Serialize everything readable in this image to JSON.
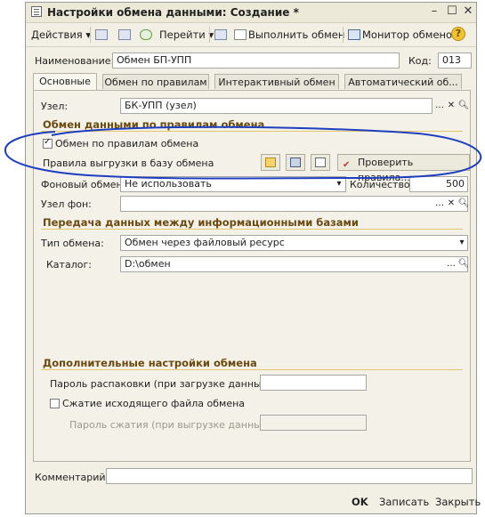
{
  "window": {
    "title": "Настройки обмена данными: Создание *"
  },
  "toolbar": {
    "actions": "Действия",
    "goto": "Перейти",
    "run_exchange": "Выполнить обмен",
    "monitor": "Монитор обменов",
    "help": "?"
  },
  "header": {
    "name_label": "Наименование:",
    "name_value": "Обмен БП-УПП",
    "code_label": "Код:",
    "code_value": "013"
  },
  "tabs": [
    "Основные",
    "Обмен по правилам",
    "Интерактивный обмен",
    "Автоматический об..."
  ],
  "rules_section": {
    "title": "Обмен данными по правилам обмена",
    "node_label": "Узел:",
    "node_value": "БК-УПП (узел)",
    "use_rules_label": "Обмен по правилам обмена",
    "use_rules_checked": true,
    "rules_label": "Правила выгрузки в базу обмена",
    "check_rules": "Проверить правила..."
  },
  "background": {
    "label": "Фоновый обмен:",
    "value": "Не использовать",
    "count_label": "Количество:",
    "count_value": "500",
    "node_bg_label": "Узел фон:"
  },
  "transfer_section": {
    "title": "Передача данных между информационными базами",
    "type_label": "Тип обмена:",
    "type_value": "Обмен через файловый ресурс",
    "catalog_label": "Каталог:",
    "catalog_value": "D:\\обмен"
  },
  "extra_section": {
    "title": "Дополнительные настройки обмена",
    "unpack_password_label": "Пароль распаковки (при загрузке данных):",
    "compress_label": "Сжатие исходящего файла обмена",
    "compress_checked": false,
    "compress_password_label": "Пароль сжатия (при выгрузке данных):"
  },
  "comment": {
    "label": "Комментарий:"
  },
  "footer": {
    "ok": "OK",
    "save": "Записать",
    "close": "Закрыть"
  },
  "colors": {
    "annotation": "#1d3fbf",
    "section_title": "#6a4a10"
  }
}
